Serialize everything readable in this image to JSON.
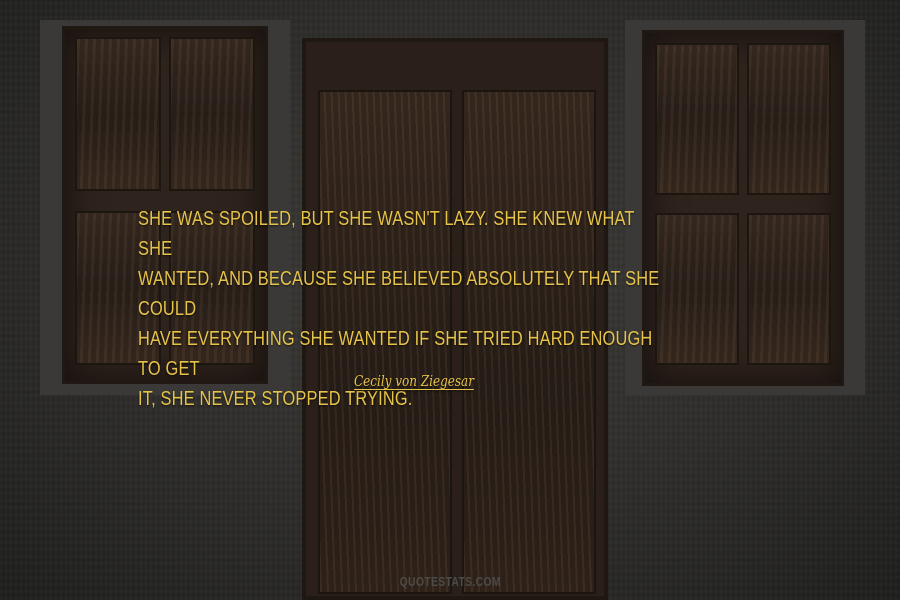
{
  "quote": {
    "lines": [
      "She was spoiled, but she wasn't lazy. She knew what she",
      "wanted, and because she believed absolutely that she could",
      "have everything she wanted if she tried hard enough to get",
      "it, she never stopped trying."
    ]
  },
  "author": "Cecily von Ziegesar",
  "watermark": "QUOTESTATS.COM",
  "colors": {
    "quote_text": "#e6c34a",
    "wall": "#2e2d2b",
    "wood": "#2f231d"
  }
}
